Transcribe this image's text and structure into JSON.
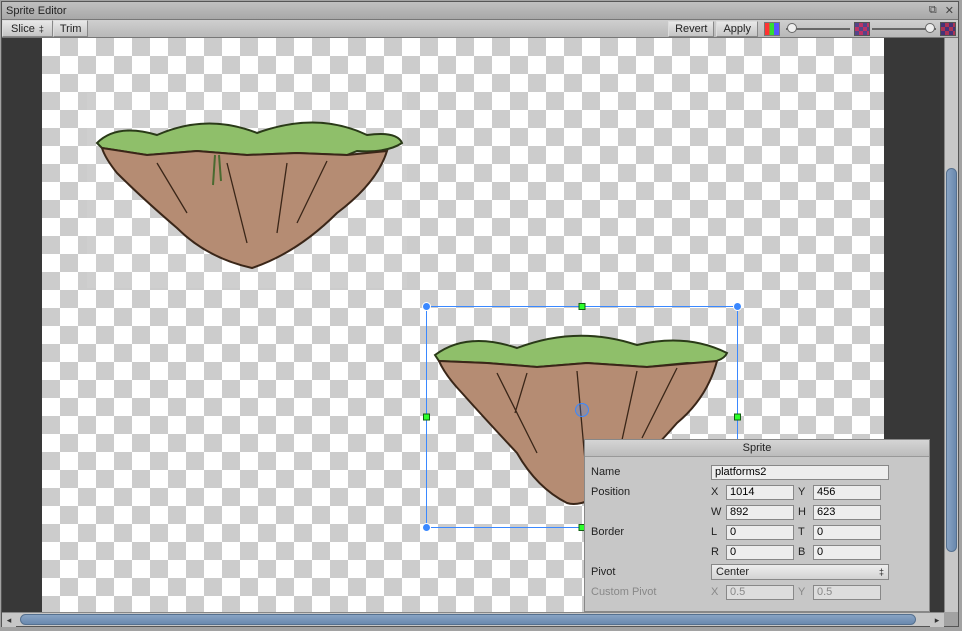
{
  "window": {
    "title": "Sprite Editor"
  },
  "toolbar": {
    "slice_label": "Slice",
    "trim_label": "Trim",
    "revert_label": "Revert",
    "apply_label": "Apply"
  },
  "panel": {
    "title": "Sprite",
    "name_label": "Name",
    "name_value": "platforms2",
    "position_label": "Position",
    "position": {
      "x_label": "X",
      "x": "1014",
      "y_label": "Y",
      "y": "456",
      "w_label": "W",
      "w": "892",
      "h_label": "H",
      "h": "623"
    },
    "border_label": "Border",
    "border": {
      "l_label": "L",
      "l": "0",
      "t_label": "T",
      "t": "0",
      "r_label": "R",
      "r": "0",
      "b_label": "B",
      "b": "0"
    },
    "pivot_label": "Pivot",
    "pivot_value": "Center",
    "custom_label": "Custom Pivot",
    "custom": {
      "x_label": "X",
      "x": "0.5",
      "y_label": "Y",
      "y": "0.5"
    }
  },
  "colors": {
    "select": "#3a88ff",
    "grass": "#8fbf6a",
    "rock": "#b58c73"
  }
}
